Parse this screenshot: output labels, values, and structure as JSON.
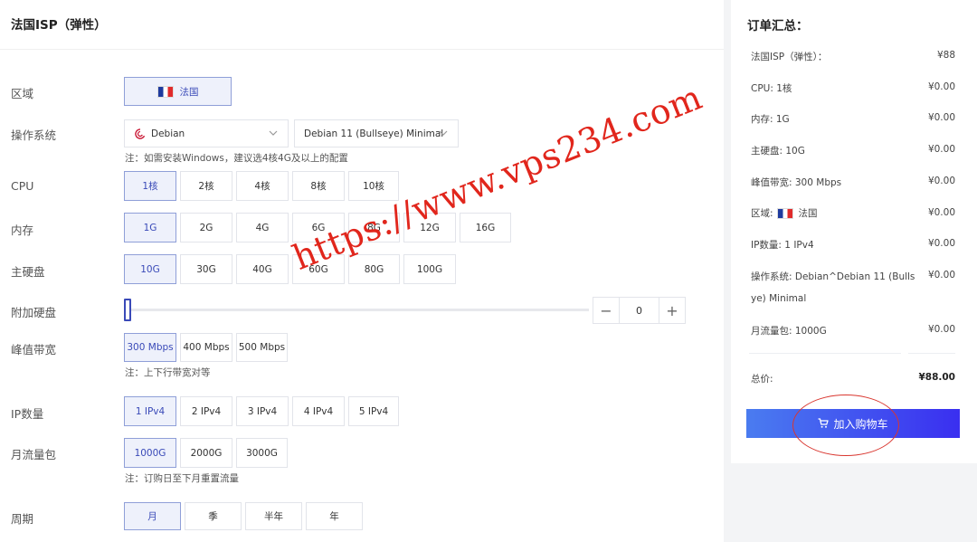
{
  "product": {
    "title": "法国ISP（弹性）"
  },
  "config": {
    "region": {
      "label": "区域",
      "value": "法国"
    },
    "os": {
      "label": "操作系统",
      "distro": "Debian",
      "version": "Debian 11 (Bullseye) Minimal",
      "note": "注：如需安装Windows，建议选4核4G及以上的配置"
    },
    "cpu": {
      "label": "CPU",
      "options": [
        "1核",
        "2核",
        "4核",
        "8核",
        "10核"
      ],
      "selected": "1核"
    },
    "memory": {
      "label": "内存",
      "options": [
        "1G",
        "2G",
        "4G",
        "6G",
        "8G",
        "12G",
        "16G"
      ],
      "selected": "1G"
    },
    "disk": {
      "label": "主硬盘",
      "options": [
        "10G",
        "30G",
        "40G",
        "60G",
        "80G",
        "100G"
      ],
      "selected": "10G"
    },
    "extra_disk": {
      "label": "附加硬盘",
      "value": "0",
      "level": 0,
      "minus": "−",
      "plus": "+"
    },
    "bandwidth": {
      "label": "峰值带宽",
      "options": [
        "300 Mbps",
        "400 Mbps",
        "500 Mbps"
      ],
      "selected": "300 Mbps",
      "note": "注：上下行带宽对等"
    },
    "ip": {
      "label": "IP数量",
      "options": [
        "1 IPv4",
        "2 IPv4",
        "3 IPv4",
        "4 IPv4",
        "5 IPv4"
      ],
      "selected": "1 IPv4"
    },
    "traffic": {
      "label": "月流量包",
      "options": [
        "1000G",
        "2000G",
        "3000G"
      ],
      "selected": "1000G",
      "note": "注：订购日至下月重置流量"
    },
    "period": {
      "label": "周期",
      "options": [
        "月",
        "季",
        "半年",
        "年"
      ],
      "selected": "月"
    }
  },
  "summary": {
    "title": "订单汇总：",
    "items": [
      {
        "label": "法国ISP（弹性）：",
        "price": "¥88"
      },
      {
        "label": "CPU: 1核",
        "price": "¥0.00"
      },
      {
        "label": "内存: 1G",
        "price": "¥0.00"
      },
      {
        "label": "主硬盘: 10G",
        "price": "¥0.00"
      },
      {
        "label": "峰值带宽: 300 Mbps",
        "price": "¥0.00"
      },
      {
        "label_prefix": "区域:",
        "label_suffix": "法国",
        "price": "¥0.00"
      },
      {
        "label": "IP数量: 1 IPv4",
        "price": "¥0.00"
      },
      {
        "label_line1": "操作系统: Debian^Debian 11 (Bulls",
        "label_line2": "ye) Minimal",
        "price": "¥0.00"
      },
      {
        "label": "月流量包: 1000G",
        "price": "¥0.00"
      }
    ],
    "total_label": "总价:",
    "total_value": "¥88.00",
    "cart_button": "加入购物车"
  },
  "watermark": "https://www.vps234.com",
  "colors": {
    "accent": "#3a4ab8",
    "selected_bg": "#eef1fb",
    "watermark": "#e1261c",
    "button_start": "#4a7cf0",
    "button_end": "#3a2ff0"
  }
}
